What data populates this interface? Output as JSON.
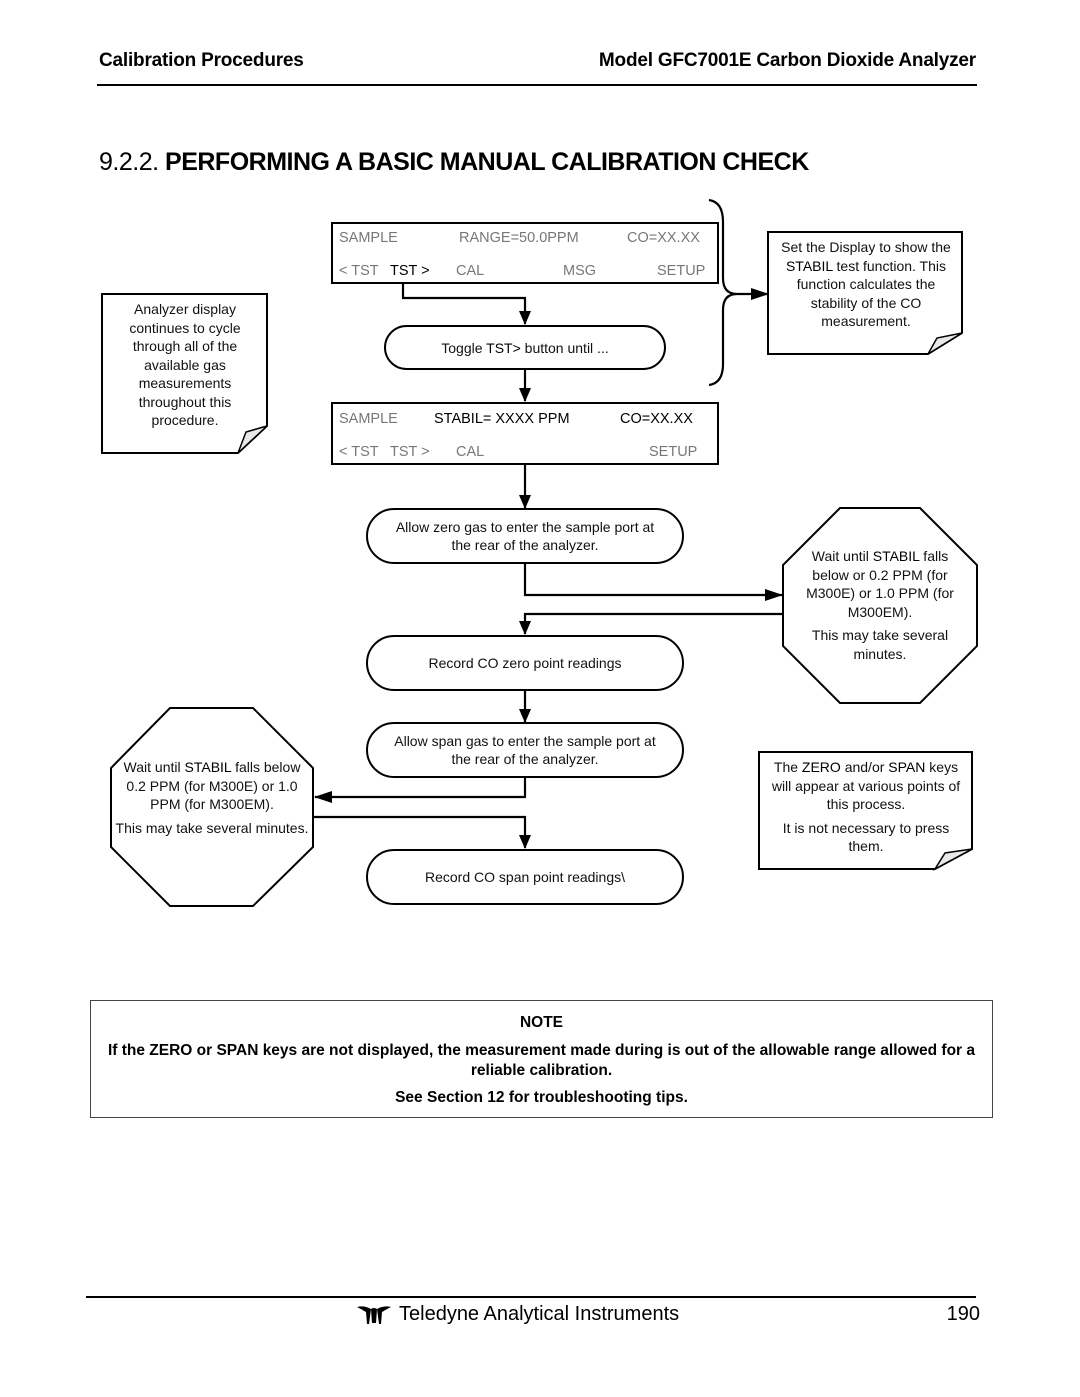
{
  "header": {
    "section": "Calibration Procedures",
    "document_title": "Model GFC7001E Carbon Dioxide Analyzer"
  },
  "section_title": {
    "number": "9.2.2.",
    "text": "PERFORMING A BASIC MANUAL CALIBRATION CHECK"
  },
  "display_1": {
    "mode": "SAMPLE",
    "field_1": "RANGE=50.0PPM",
    "field_2": "CO=XX.XX",
    "buttons": [
      "< TST",
      "TST >",
      "CAL",
      "MSG",
      "SETUP"
    ],
    "highlighted_button": "TST >"
  },
  "display_2": {
    "mode": "SAMPLE",
    "field_1": "STABIL= XXXX PPM",
    "field_2": "CO=XX.XX",
    "buttons": [
      "< TST",
      "TST >",
      "CAL",
      "",
      "SETUP"
    ]
  },
  "steps": {
    "toggle": {
      "prefix": "Toggle ",
      "key": "TST>",
      "suffix": " button until ..."
    },
    "zero_gas": "Allow zero gas to enter the sample port at the rear of the analyzer.",
    "record_zero": "Record CO zero point readings",
    "span_gas": "Allow span gas to enter the sample port at the rear of the analyzer.",
    "record_span": "Record CO span point readings\\"
  },
  "callouts": {
    "cycle_note": "Analyzer display continues to cycle through all of the available gas measurements throughout this procedure.",
    "stabil_note": {
      "pre": "Set the Display to show the ",
      "key": "STABIL",
      "post": " test function. This function calculates the stability of the CO measurement."
    },
    "wait_zero": {
      "line1_pre": "Wait until ",
      "key": "STABIL",
      "line1_post": " falls below or 0.2 PPM (for M300E) or 1.0 PPM (for M300EM).",
      "line2": "This may take several minutes."
    },
    "wait_span": {
      "line1_pre": "Wait until ",
      "key": "STABIL",
      "line1_post": " falls below 0.2 PPM (for M300E) or 1.0 PPM (for M300EM).",
      "line2": "This may take several minutes."
    },
    "keys_note": {
      "pre": "The ",
      "key1": "ZERO",
      "mid": " and/or ",
      "key2": "SPAN",
      "post": " keys will appear at various points of this process.",
      "line2": "It is not necessary to press them."
    }
  },
  "note": {
    "title": "NOTE",
    "body": "If the ZERO or SPAN keys are not displayed, the measurement made during is out of the allowable range allowed for a reliable calibration.",
    "see": "See Section 12 for troubleshooting tips."
  },
  "footer": {
    "brand": "Teledyne Analytical Instruments",
    "page_number": "190"
  }
}
